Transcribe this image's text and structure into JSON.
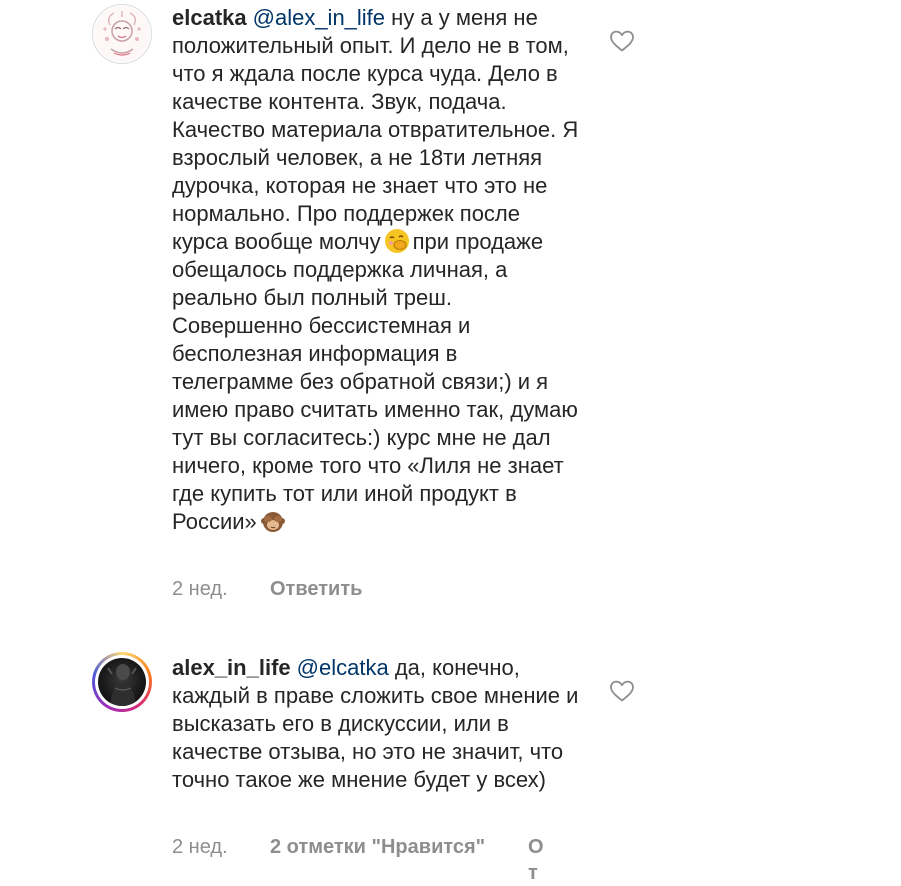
{
  "comments": [
    {
      "username": "elcatka",
      "mention": "@alex_in_life",
      "text_part1": "ну а у меня не положительный опыт. И дело не в том, что я ждала после курса чуда. Дело в качестве контента. Звук, подача. Качество материала отвратительное. Я взрослый человек, а не 18ти летняя дурочка, которая не знает что это не нормально. Про поддержек после курса вообще молчу",
      "emoji1": "face-with-hand-over-mouth-emoji",
      "text_part2": "при продаже обещалось поддержка личная, а реально был полный треш. Совершенно бессистемная и бесполезная информация в телеграмме без обратной связи;) и я имею право считать именно так, думаю тут вы согласитесь:) курс мне не дал ничего, кроме того что «Лиля не знает где купить тот или иной продукт в России»",
      "emoji2": "see-no-evil-monkey-emoji",
      "time": "2 нед.",
      "reply_label": "Ответить",
      "like_icon": "heart-outline-icon"
    },
    {
      "username": "alex_in_life",
      "mention": "@elcatka",
      "text": "да, конечно, каждый в праве сложить свое мнение и высказать его в дискуссии, или в качестве отзыва, но это не значит, что точно такое же мнение будет у всех)",
      "time": "2 нед.",
      "likes_label": "2 отметки \"Нравится\"",
      "reply_label_cut": "От",
      "like_icon": "heart-outline-icon"
    }
  ]
}
